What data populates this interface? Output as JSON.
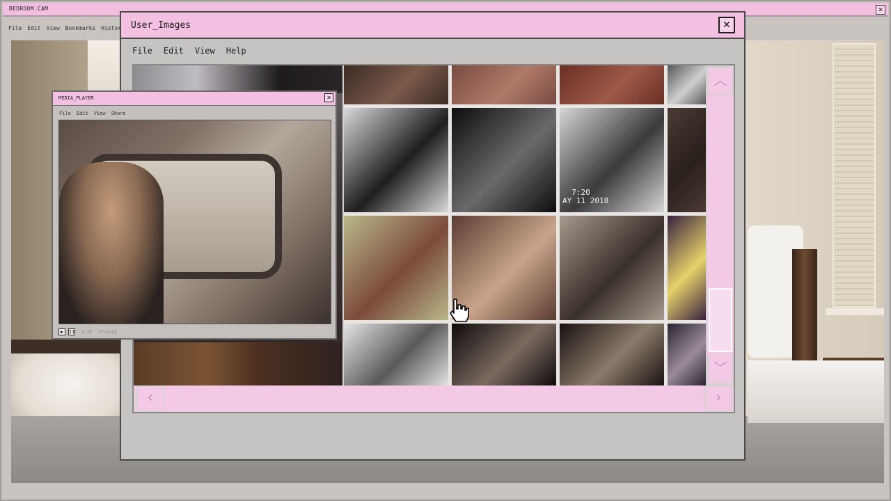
{
  "outer_window": {
    "title": "BEDROOM.CAM",
    "close_label": "✕",
    "menu": [
      "File",
      "Edit",
      "View",
      "Bookmarks",
      "Histor"
    ]
  },
  "images_window": {
    "title": "User_Images",
    "close_label": "✕",
    "menu": [
      "File",
      "Edit",
      "View",
      "Help"
    ],
    "scroll_up": "︿",
    "scroll_down": "﹀",
    "scroll_left": "‹",
    "scroll_right": "›",
    "thumbnails": [
      {
        "color": "#3b2a24",
        "color2": "#7a5a4a"
      },
      {
        "color": "#7a4a40",
        "color2": "#b07a6a"
      },
      {
        "color": "#6a2e24",
        "color2": "#9e5a48"
      },
      {
        "color": "#585858",
        "color2": "#cfcfcf"
      },
      {
        "color": "#d9d9d9",
        "color2": "#1e1e1e"
      },
      {
        "color": "#0d0d0d",
        "color2": "#6a6a6a"
      },
      {
        "color": "#d6d6d6",
        "color2": "#3a3a3a",
        "timestamp": "  7:20\nAY 11 2018"
      },
      {
        "color": "#4a3a34",
        "color2": "#2a201c"
      },
      {
        "color": "#b9b88a",
        "color2": "#7b4a3a"
      },
      {
        "color": "#5b3c32",
        "color2": "#c9a48a"
      },
      {
        "color": "#a69a8e",
        "color2": "#3a302a"
      },
      {
        "color": "#3a2240",
        "color2": "#e6d26a"
      },
      {
        "color": "#e4e4e4",
        "color2": "#5a5a5a"
      },
      {
        "color": "#0e0a0a",
        "color2": "#7a6a60"
      },
      {
        "color": "#1a1210",
        "color2": "#8a7a6a"
      },
      {
        "color": "#2a2430",
        "color2": "#9a8a9a"
      }
    ]
  },
  "media_player": {
    "title": "MEDIA_PLAYER",
    "close_label": "✕",
    "menu": [
      "File",
      "Edit",
      "View",
      "Share"
    ],
    "play_label": "▶",
    "pause_label": "II",
    "time": "0:00",
    "status": "Playing"
  }
}
